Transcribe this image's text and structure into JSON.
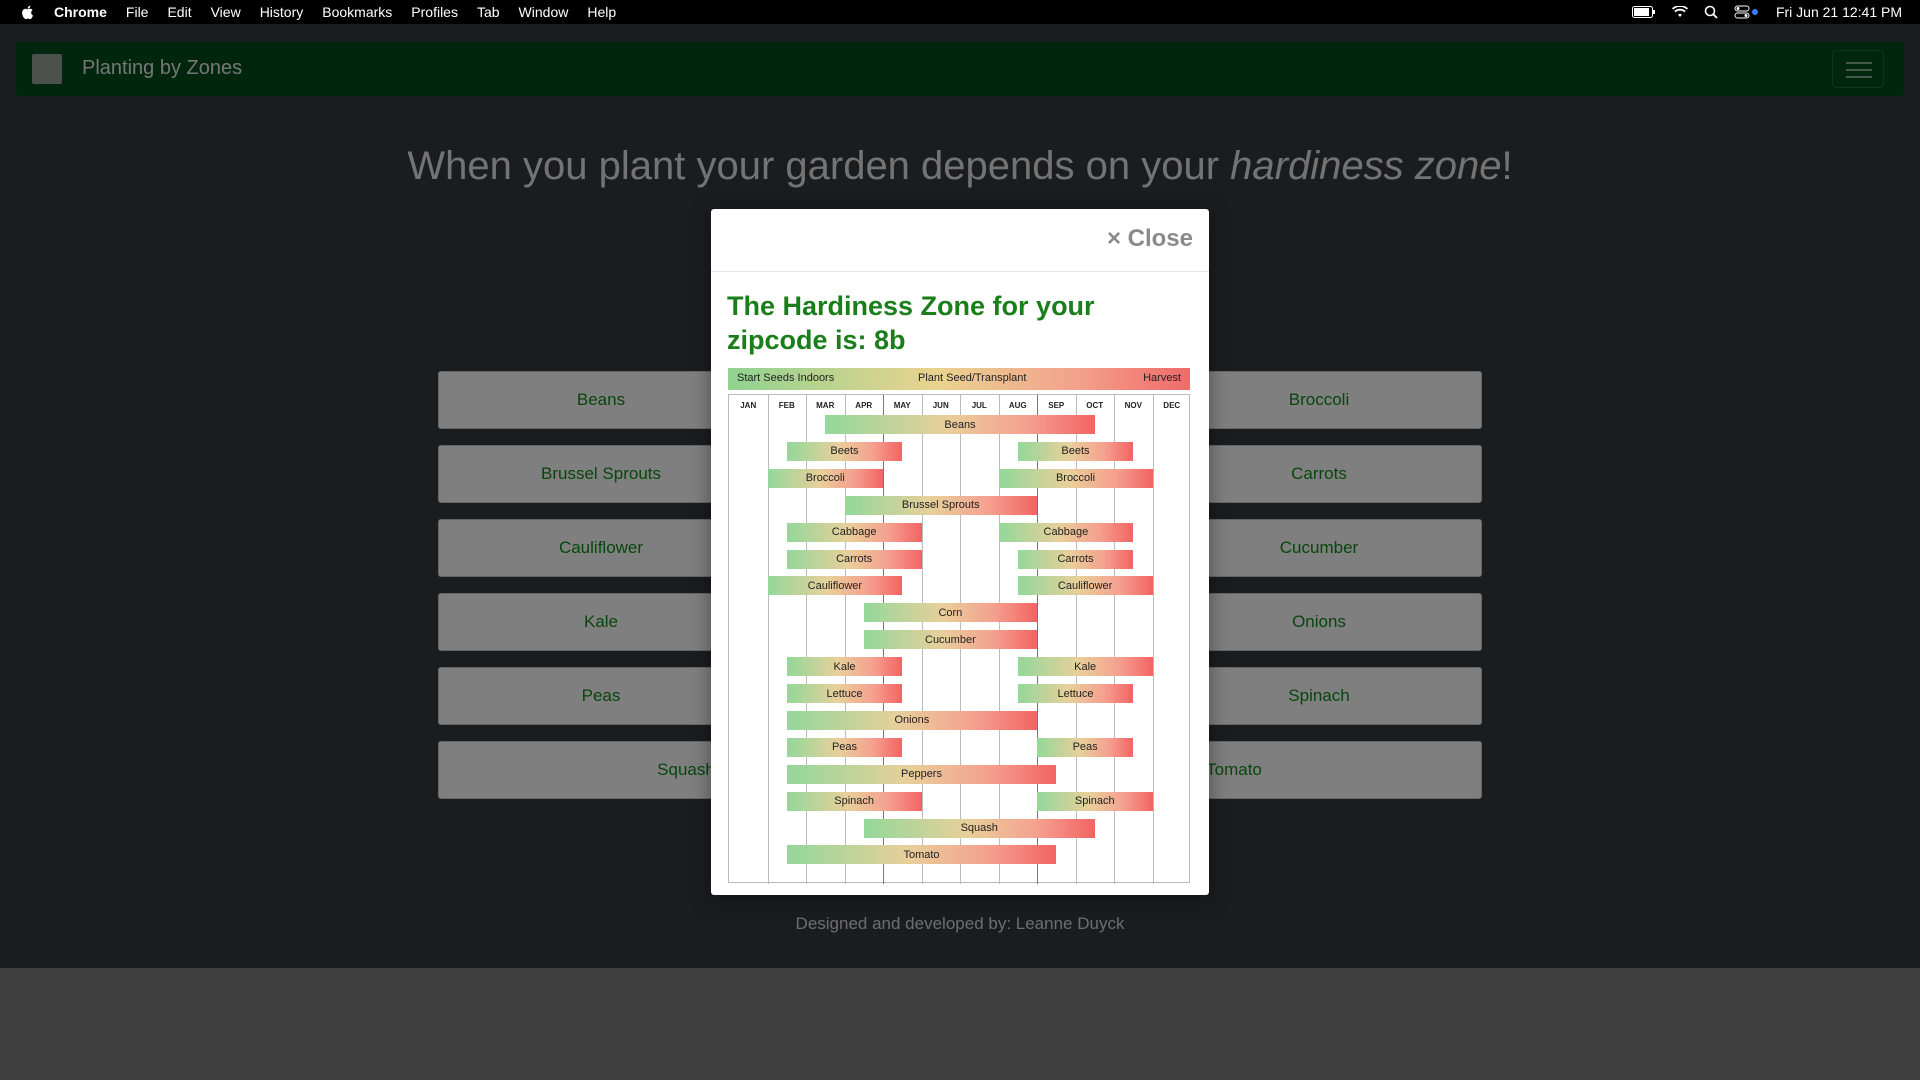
{
  "menubar": {
    "items": [
      "Chrome",
      "File",
      "Edit",
      "View",
      "History",
      "Bookmarks",
      "Profiles",
      "Tab",
      "Window",
      "Help"
    ],
    "datetime": "Fri Jun 21  12:41 PM"
  },
  "navbar": {
    "brand": "Planting by Zones"
  },
  "hero": {
    "title_part1": "When you plant your garden depends on your ",
    "title_em": "hardiness zone",
    "title_part2": "!"
  },
  "vegetables": {
    "left": [
      "Beans",
      "Brussel Sprouts",
      "Cauliflower",
      "Kale",
      "Peas",
      "Squash"
    ],
    "right": [
      "Broccoli",
      "Carrots",
      "Cucumber",
      "Onions",
      "Spinach",
      "Tomato"
    ]
  },
  "footer": {
    "text": "Designed and developed by: Leanne Duyck"
  },
  "modal": {
    "close_label": "× Close",
    "title": "The Hardiness Zone for your zipcode is: 8b"
  },
  "planting_chart": {
    "legend": [
      "Start Seeds Indoors",
      "Plant Seed/Transplant",
      "Harvest"
    ],
    "months": [
      "JAN",
      "FEB",
      "MAR",
      "APR",
      "MAY",
      "JUN",
      "JUL",
      "AUG",
      "SEP",
      "OCT",
      "NOV",
      "DEC"
    ],
    "bars": [
      {
        "label": "Beans",
        "start": 2.5,
        "end": 9.5
      },
      {
        "label": "Beets",
        "start": 1.5,
        "end": 4.5
      },
      {
        "label": "Beets",
        "start": 7.5,
        "end": 10.5
      },
      {
        "label": "Broccoli",
        "start": 1.0,
        "end": 4.0
      },
      {
        "label": "Broccoli",
        "start": 7.0,
        "end": 11.0
      },
      {
        "label": "Brussel Sprouts",
        "start": 3.0,
        "end": 8.0
      },
      {
        "label": "Cabbage",
        "start": 1.5,
        "end": 5.0
      },
      {
        "label": "Cabbage",
        "start": 7.0,
        "end": 10.5
      },
      {
        "label": "Carrots",
        "start": 1.5,
        "end": 5.0
      },
      {
        "label": "Carrots",
        "start": 7.5,
        "end": 10.5
      },
      {
        "label": "Cauliflower",
        "start": 1.0,
        "end": 4.5
      },
      {
        "label": "Cauliflower",
        "start": 7.5,
        "end": 11.0
      },
      {
        "label": "Corn",
        "start": 3.5,
        "end": 8.0
      },
      {
        "label": "Cucumber",
        "start": 3.5,
        "end": 8.0
      },
      {
        "label": "Kale",
        "start": 1.5,
        "end": 4.5
      },
      {
        "label": "Kale",
        "start": 7.5,
        "end": 11.0
      },
      {
        "label": "Lettuce",
        "start": 1.5,
        "end": 4.5
      },
      {
        "label": "Lettuce",
        "start": 7.5,
        "end": 10.5
      },
      {
        "label": "Onions",
        "start": 1.5,
        "end": 8.0
      },
      {
        "label": "Peas",
        "start": 1.5,
        "end": 4.5
      },
      {
        "label": "Peas",
        "start": 8.0,
        "end": 10.5
      },
      {
        "label": "Peppers",
        "start": 1.5,
        "end": 8.5
      },
      {
        "label": "Spinach",
        "start": 1.5,
        "end": 5.0
      },
      {
        "label": "Spinach",
        "start": 8.0,
        "end": 11.0
      },
      {
        "label": "Squash",
        "start": 3.5,
        "end": 9.5
      },
      {
        "label": "Tomato",
        "start": 1.5,
        "end": 8.5
      }
    ],
    "rows": [
      "Beans",
      "Beets",
      "Broccoli",
      "Brussel Sprouts",
      "Cabbage",
      "Carrots",
      "Cauliflower",
      "Corn",
      "Cucumber",
      "Kale",
      "Lettuce",
      "Onions",
      "Peas",
      "Peppers",
      "Spinach",
      "Squash",
      "Tomato"
    ]
  }
}
